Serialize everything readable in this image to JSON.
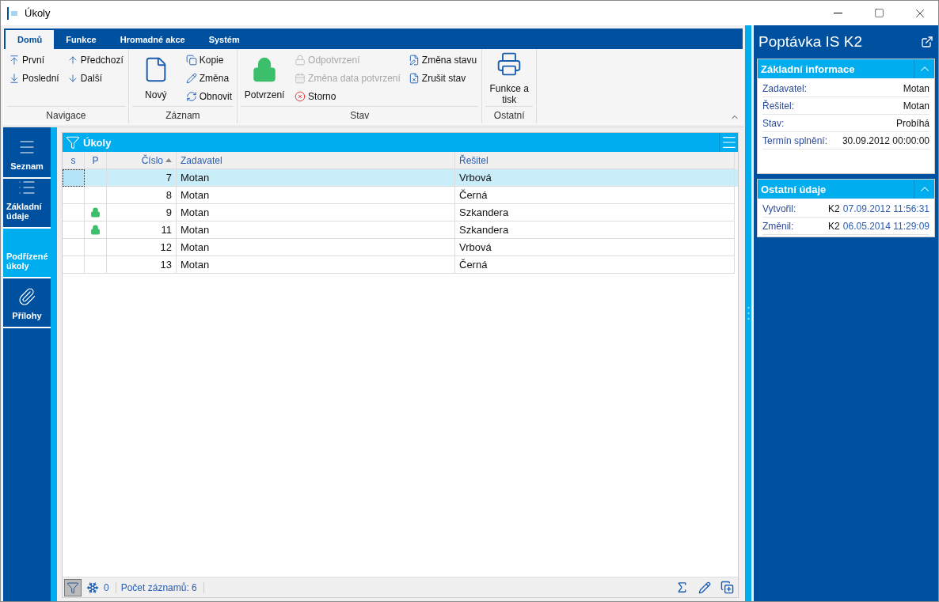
{
  "window": {
    "title": "Úkoly"
  },
  "ribbon": {
    "tabs": [
      {
        "label": "Domů",
        "selected": true
      },
      {
        "label": "Funkce",
        "selected": false
      },
      {
        "label": "Hromadné akce",
        "selected": false
      },
      {
        "label": "Systém",
        "selected": false
      }
    ],
    "groups": [
      {
        "label": "Navigace",
        "columns": [
          [
            {
              "label": "První",
              "kind": "small",
              "disabled": false
            },
            {
              "label": "Poslední",
              "kind": "small",
              "disabled": false
            }
          ],
          [
            {
              "label": "Předchozí",
              "kind": "small",
              "disabled": false
            },
            {
              "label": "Další",
              "kind": "small",
              "disabled": false
            }
          ]
        ]
      },
      {
        "label": "Záznam",
        "columns": [
          [
            {
              "label": "Nový",
              "kind": "large",
              "disabled": false
            }
          ],
          [
            {
              "label": "Kopie",
              "kind": "small",
              "disabled": false
            },
            {
              "label": "Změna",
              "kind": "small",
              "disabled": false
            },
            {
              "label": "Obnovit",
              "kind": "small",
              "disabled": false
            }
          ]
        ]
      },
      {
        "label": "Stav",
        "columns": [
          [
            {
              "label": "Potvrzení",
              "kind": "large",
              "disabled": false
            }
          ],
          [
            {
              "label": "Odpotvrzení",
              "kind": "small",
              "disabled": true
            },
            {
              "label": "Změna data potvrzení",
              "kind": "small",
              "disabled": true
            },
            {
              "label": "Storno",
              "kind": "small",
              "disabled": false
            }
          ],
          [
            {
              "label": "Změna stavu",
              "kind": "small",
              "disabled": false
            },
            {
              "label": "Zrušit stav",
              "kind": "small",
              "disabled": false
            }
          ]
        ]
      },
      {
        "label": "Ostatní",
        "columns": [
          [
            {
              "label": "Funkce a tisk",
              "kind": "large",
              "disabled": false
            }
          ]
        ]
      }
    ]
  },
  "sidebar": {
    "items": [
      {
        "label": "Seznam",
        "selected": false
      },
      {
        "label": "Základní údaje",
        "selected": false
      },
      {
        "label": "Podřízené úkoly",
        "selected": true
      },
      {
        "label": "Přílohy",
        "selected": false
      }
    ]
  },
  "grid": {
    "title": "Úkoly",
    "columns": [
      "s",
      "P",
      "Číslo",
      "Zadavatel",
      "Řešitel"
    ],
    "rows": [
      {
        "cislo": "7",
        "zadavatel": "Motan",
        "resitel": "Vrbová",
        "locked": false,
        "selected": true
      },
      {
        "cislo": "8",
        "zadavatel": "Motan",
        "resitel": "Černá",
        "locked": false,
        "selected": false
      },
      {
        "cislo": "9",
        "zadavatel": "Motan",
        "resitel": "Szkandera",
        "locked": true,
        "selected": false
      },
      {
        "cislo": "11",
        "zadavatel": "Motan",
        "resitel": "Szkandera",
        "locked": true,
        "selected": false
      },
      {
        "cislo": "12",
        "zadavatel": "Motan",
        "resitel": "Vrbová",
        "locked": false,
        "selected": false
      },
      {
        "cislo": "13",
        "zadavatel": "Motan",
        "resitel": "Černá",
        "locked": false,
        "selected": false
      }
    ],
    "footer": {
      "frozen_count": "0",
      "record_count": "Počet záznamů: 6"
    }
  },
  "detail": {
    "title": "Poptávka IS K2",
    "sections": [
      {
        "title": "Základní informace",
        "expanded": true,
        "fields": [
          {
            "label": "Zadavatel:",
            "value": "Motan"
          },
          {
            "label": "Řešitel:",
            "value": "Motan"
          },
          {
            "label": "Stav:",
            "value": "Probíhá"
          },
          {
            "label": "Termín splnění:",
            "value": "30.09.2012 00:00:00"
          }
        ]
      },
      {
        "title": "Ostatní údaje",
        "expanded": true,
        "fields": [
          {
            "label": "Vytvořil:",
            "user": "K2",
            "value": "07.09.2012 11:56:31"
          },
          {
            "label": "Změnil:",
            "user": "K2",
            "value": "06.05.2014 11:29:09"
          }
        ]
      }
    ]
  }
}
